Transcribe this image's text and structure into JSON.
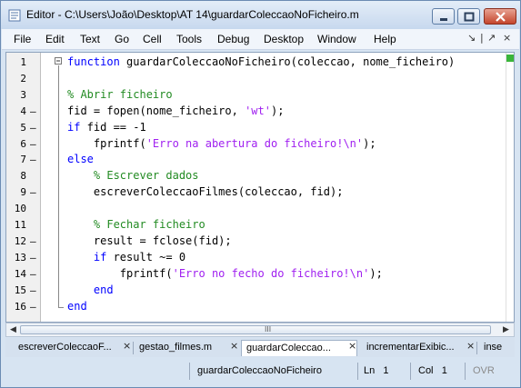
{
  "window": {
    "title": "Editor - C:\\Users\\João\\Desktop\\AT 14\\guardarColeccaoNoFicheiro.m",
    "controls": [
      "minimize-icon",
      "maximize-icon",
      "close-icon"
    ]
  },
  "menubar": {
    "items": [
      "File",
      "Edit",
      "Text",
      "Go",
      "Cell",
      "Tools",
      "Debug",
      "Desktop",
      "Window",
      "Help"
    ],
    "right_glyphs": [
      "↘",
      "|",
      "↗",
      "×"
    ]
  },
  "editor": {
    "line_numbers": [
      "1",
      "2",
      "3",
      "4",
      "5",
      "6",
      "7",
      "8",
      "9",
      "10",
      "11",
      "12",
      "13",
      "14",
      "15",
      "16"
    ],
    "breakpoint_dashes": [
      "",
      "",
      "",
      "—",
      "—",
      "—",
      "—",
      "",
      "—",
      "",
      "",
      "—",
      "—",
      "—",
      "—",
      "—"
    ],
    "lines": [
      [
        {
          "t": "function",
          "c": "kw"
        },
        {
          "t": " guardarColeccaoNoFicheiro(coleccao, nome_ficheiro)",
          "c": ""
        }
      ],
      [],
      [
        {
          "t": "% Abrir ficheiro",
          "c": "cm"
        }
      ],
      [
        {
          "t": "fid = fopen(nome_ficheiro, ",
          "c": ""
        },
        {
          "t": "'wt'",
          "c": "st"
        },
        {
          "t": ");",
          "c": ""
        }
      ],
      [
        {
          "t": "if",
          "c": "kw"
        },
        {
          "t": " fid == -1",
          "c": ""
        }
      ],
      [
        {
          "t": "    fprintf(",
          "c": ""
        },
        {
          "t": "'Erro na abertura do ficheiro!\\n'",
          "c": "st"
        },
        {
          "t": ");",
          "c": ""
        }
      ],
      [
        {
          "t": "else",
          "c": "kw"
        }
      ],
      [
        {
          "t": "    % Escrever dados",
          "c": "cm"
        }
      ],
      [
        {
          "t": "    escreverColeccaoFilmes(coleccao, fid);",
          "c": ""
        }
      ],
      [],
      [
        {
          "t": "    % Fechar ficheiro",
          "c": "cm"
        }
      ],
      [
        {
          "t": "    result = fclose(fid);",
          "c": ""
        }
      ],
      [
        {
          "t": "    ",
          "c": ""
        },
        {
          "t": "if",
          "c": "kw"
        },
        {
          "t": " result ~= 0",
          "c": ""
        }
      ],
      [
        {
          "t": "        fprintf(",
          "c": ""
        },
        {
          "t": "'Erro no fecho do ficheiro!\\n'",
          "c": "st"
        },
        {
          "t": ");",
          "c": ""
        }
      ],
      [
        {
          "t": "    ",
          "c": ""
        },
        {
          "t": "end",
          "c": "kw"
        }
      ],
      [
        {
          "t": "end",
          "c": "kw"
        }
      ]
    ]
  },
  "tabs": [
    {
      "label": "escreverColeccaoF...",
      "active": false
    },
    {
      "label": "gestao_filmes.m",
      "active": false
    },
    {
      "label": "guardarColeccao...",
      "active": true
    },
    {
      "label": "incrementarExibic...",
      "active": false
    },
    {
      "label": "inse",
      "active": false
    }
  ],
  "status": {
    "function_name": "guardarColeccaoNoFicheiro",
    "ln_label": "Ln",
    "ln_value": "1",
    "col_label": "Col",
    "col_value": "1",
    "ovr": "OVR"
  },
  "colors": {
    "keyword": "#0000ff",
    "comment": "#228b22",
    "string": "#a020f0"
  }
}
